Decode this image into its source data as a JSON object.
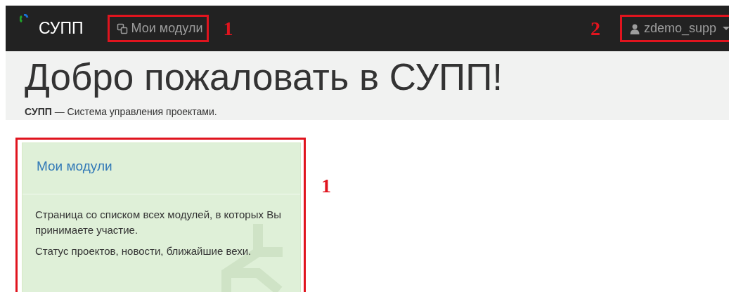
{
  "navbar": {
    "brand": "СУПП",
    "links": [
      {
        "label": "Мои модули"
      }
    ],
    "user": "zdemo_supp"
  },
  "jumbotron": {
    "title": "Добро пожаловать в СУПП!",
    "subtitle": "**СУПП** — Система управления проектами."
  },
  "cards": [
    {
      "title": "Мои модули",
      "paragraphs": [
        "Страница со списком всех модулей, в которых Вы принимаете участие.",
        "Статус проектов, новости, ближайшие вехи."
      ]
    }
  ],
  "annotations": [
    {
      "label": "1"
    },
    {
      "label": "2"
    },
    {
      "label": "1"
    }
  ]
}
